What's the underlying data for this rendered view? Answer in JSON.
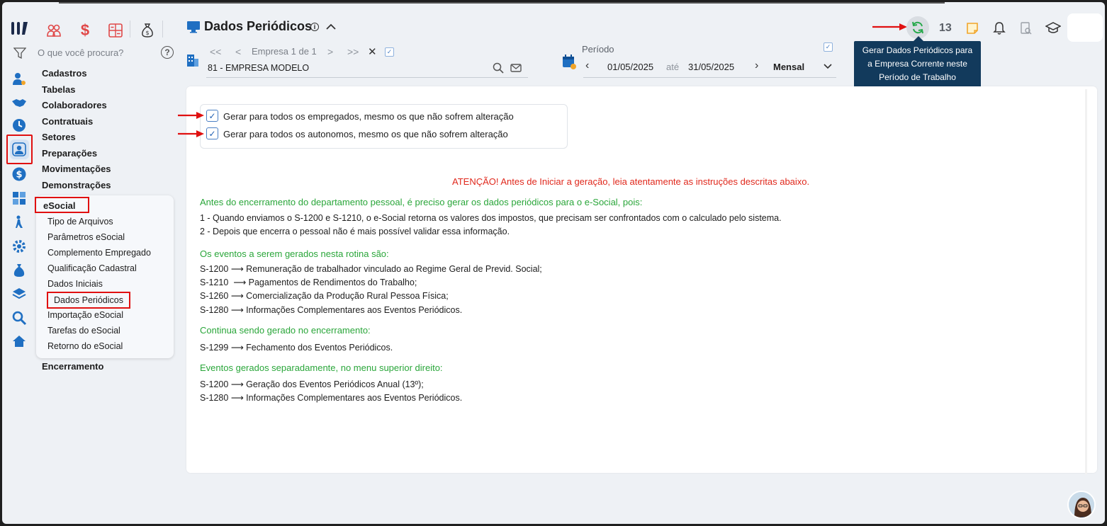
{
  "header": {
    "title": "Dados Periódicos",
    "info": "i"
  },
  "search": {
    "placeholder": "O que você procura?",
    "help": "?"
  },
  "menu": {
    "items": [
      "Cadastros",
      "Tabelas",
      "Colaboradores",
      "Contratuais",
      "Setores",
      "Preparações",
      "Movimentações",
      "Demonstrações"
    ],
    "esocial": "eSocial",
    "esocial_items": [
      "Tipo de Arquivos",
      "Parâmetros eSocial",
      "Complemento Empregado",
      "Qualificação Cadastral",
      "Dados Iniciais",
      "Dados Periódicos",
      "Importação eSocial",
      "Tarefas do eSocial",
      "Retorno do eSocial"
    ],
    "encerramento": "Encerramento"
  },
  "company": {
    "first": "<<",
    "prev": "<",
    "label": "Empresa 1 de 1",
    "next": ">",
    "last": ">>",
    "close": "✕",
    "value": "81 - EMPRESA MODELO"
  },
  "period": {
    "label": "Período",
    "start": "01/05/2025",
    "sep": "até",
    "end": "31/05/2025",
    "type": "Mensal"
  },
  "topright": {
    "count": "13",
    "tooltip_lines": [
      "Gerar Dados Periódicos para",
      "a Empresa Corrente neste",
      "Período de Trabalho"
    ]
  },
  "options": {
    "opt1": "Gerar para todos os empregados, mesmo os que não sofrem alteração",
    "opt2": "Gerar para todos os autonomos, mesmo os que não sofrem alteração"
  },
  "content": {
    "warning": "ATENÇÃO! Antes de Iniciar a geração, leia atentamente as instruções descritas abaixo.",
    "h1": "Antes do encerramento do departamento pessoal, é preciso gerar os dados periódicos para o e-Social, pois:",
    "p1": "1 - Quando enviamos o S-1200 e S-1210, o e-Social retorna os valores dos impostos, que precisam ser confrontados com o calculado pelo sistema.",
    "p2": "2 - Depois que encerra o pessoal não é mais possível validar essa informação.",
    "h2": "Os eventos a serem gerados nesta rotina são:",
    "e1": "S-1200 ⟶ Remuneração de trabalhador vinculado ao Regime Geral de Previd. Social;",
    "e2": "S-1210  ⟶ Pagamentos de Rendimentos do Trabalho;",
    "e3": "S-1260 ⟶ Comercialização da Produção Rural Pessoa Física;",
    "e4": "S-1280 ⟶ Informações Complementares aos Eventos Periódicos.",
    "h3": "Continua sendo gerado no encerramento:",
    "e5": "S-1299 ⟶ Fechamento dos Eventos Periódicos.",
    "h4": "Eventos gerados separadamente, no menu superior direito:",
    "e6": "S-1200 ⟶ Geração dos Eventos Periódicos Anual (13º);",
    "e7": "S-1280 ⟶ Informações Complementares aos Eventos Periódicos."
  },
  "colors": {
    "accent_red": "#e01010",
    "green": "#2aa63a",
    "warning": "#e0281c",
    "tooltip_bg": "#123a5c"
  }
}
